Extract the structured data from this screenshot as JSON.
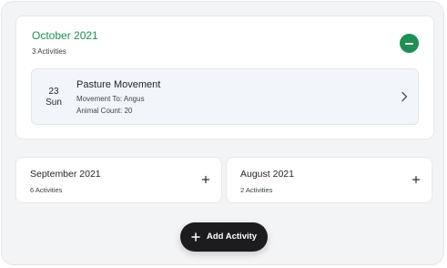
{
  "expanded_month": {
    "title": "October 2021",
    "count": "3 Activities",
    "activity": {
      "day": "23",
      "weekday": "Sun",
      "title": "Pasture Movement",
      "line1": "Movement To: Angus",
      "line2": "Animal Count: 20"
    },
    "icons": {
      "collapse": "minus-circle-icon",
      "open": "chevron-right-icon"
    }
  },
  "collapsed_months": [
    {
      "title": "September 2021",
      "count": "6 Activities",
      "icon": "plus-icon"
    },
    {
      "title": "August 2021",
      "count": "2 Activities",
      "icon": "plus-icon"
    }
  ],
  "add_button": {
    "label": "Add Activity",
    "icon": "plus-icon"
  },
  "colors": {
    "accent_green": "#1f8f55",
    "activity_bg": "#f2f6fb",
    "fab_bg": "#1c1c1e",
    "page_bg": "#f3f4f6"
  }
}
